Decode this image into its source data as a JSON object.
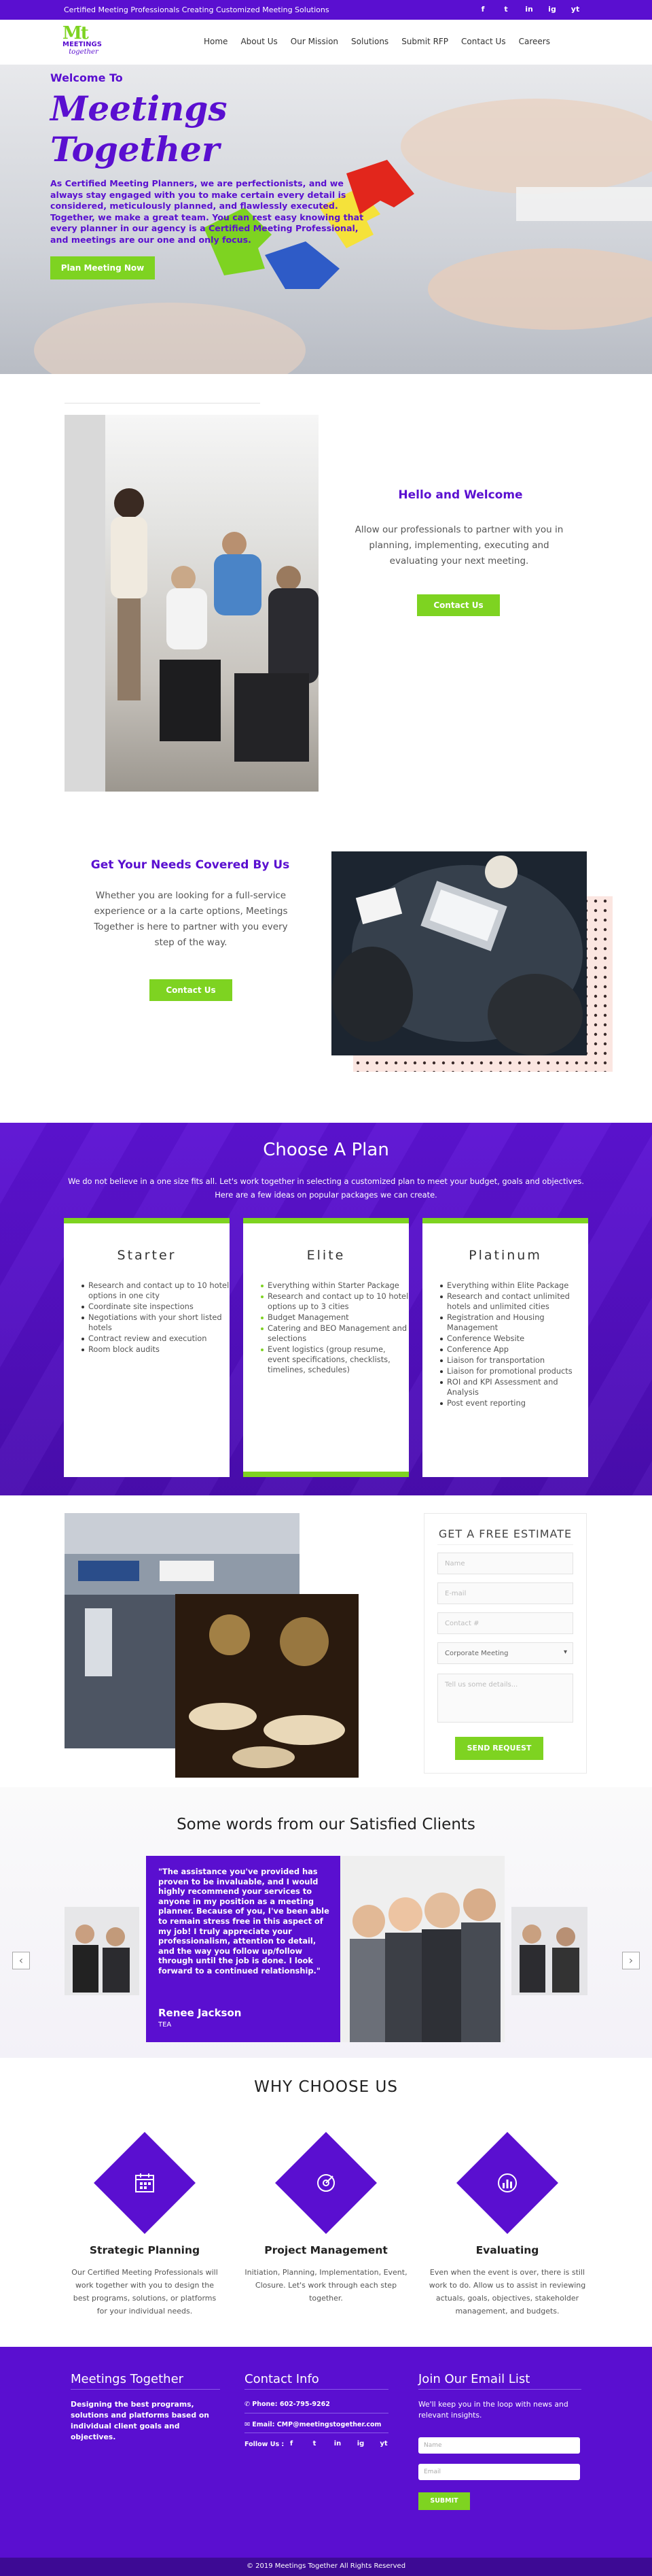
{
  "topbar": {
    "tagline": "Certified Meeting Professionals Creating Customized Meeting Solutions",
    "social": [
      "f",
      "t",
      "in",
      "ig",
      "yt"
    ]
  },
  "nav": {
    "logo_letters": "Mt",
    "logo_text": "MEETINGS",
    "logo_script": "together",
    "items": [
      "Home",
      "About Us",
      "Our Mission",
      "Solutions",
      "Submit RFP",
      "Contact Us",
      "Careers"
    ]
  },
  "hero": {
    "subtitle": "Welcome To",
    "title": "Meetings Together",
    "paragraph": "As Certified Meeting Planners, we are perfectionists, and we always stay engaged with you to make certain every detail is considered, meticulously planned, and flawlessly executed. Together, we make a great team. You can rest easy knowing that every planner in our agency is a Certified Meeting Professional, and meetings are our one and only focus.",
    "cta": "Plan Meeting Now"
  },
  "hello": {
    "title": "Hello and Welcome",
    "text": "Allow our professionals to partner with you in planning, implementing, executing and evaluating your next meeting.",
    "cta": "Contact Us"
  },
  "needs": {
    "title": "Get Your Needs Covered By Us",
    "text": "Whether you are looking for a full-service experience or a la carte options, Meetings Together is here to partner with you every step of the way.",
    "cta": "Contact Us"
  },
  "plans": {
    "title": "Choose A Plan",
    "intro": "We do not believe in a one size fits all. Let's work together in selecting a customized plan to meet your budget, goals and objectives. Here are a few ideas on popular packages we can create.",
    "cards": [
      {
        "name": "Starter",
        "items": [
          "Research and contact up to 10 hotel options in one city",
          "Coordinate site inspections",
          "Negotiations with your short listed hotels",
          "Contract review and execution",
          "Room block audits"
        ]
      },
      {
        "name": "Elite",
        "items": [
          "Everything within Starter Package",
          "Research and contact up to 10 hotel options up to 3 cities",
          "Budget Management",
          "Catering and BEO Management and selections",
          "Event logistics (group resume, event specifications, checklists, timelines, schedules)"
        ]
      },
      {
        "name": "Platinum",
        "items": [
          "Everything within Elite Package",
          "Research and contact unlimited hotels and unlimited cities",
          "Registration and Housing Management",
          "Conference Website",
          "Conference App",
          "Liaison for transportation",
          "Liaison for promotional products",
          "ROI and KPI Assessment and Analysis",
          "Post event reporting"
        ]
      }
    ]
  },
  "estimate": {
    "title": "GET A FREE ESTIMATE",
    "name_ph": "Name",
    "email_ph": "E-mail",
    "contact_ph": "Contact #",
    "select": "Corporate Meeting",
    "message_ph": "Tell us some details...",
    "submit": "SEND REQUEST"
  },
  "testimonials": {
    "title": "Some words from our Satisfied Clients",
    "quote": "\"The assistance you've provided has proven to be invaluable, and I would highly recommend your services to anyone in my position as a meeting planner. Because of you, I've been able to remain stress free in this aspect of my job! I truly appreciate your professionalism, attention to detail, and the way you follow up/follow through until the job is done. I look forward to a continued relationship.\"",
    "author": "Renee Jackson",
    "org": "TEA"
  },
  "why": {
    "title": "WHY CHOOSE US",
    "items": [
      {
        "title": "Strategic Planning",
        "text": "Our Certified Meeting Professionals will work together with you to design the best programs, solutions, or platforms for your individual needs."
      },
      {
        "title": "Project Management",
        "text": "Initiation, Planning, Implementation, Event, Closure. Let's work through each step together."
      },
      {
        "title": "Evaluating",
        "text": "Even when the event is over, there is still work to do. Allow us to assist in reviewing actuals, goals, objectives, stakeholder management, and budgets."
      }
    ]
  },
  "footer": {
    "col1_title": "Meetings Together",
    "col1_text": "Designing the best programs, solutions and platforms based on individual client goals and objectives.",
    "col2_title": "Contact Info",
    "phone": "Phone: 602-795-9262",
    "email": "Email: CMP@meetingstogether.com",
    "follow": "Follow Us :",
    "col3_title": "Join Our Email List",
    "col3_text": "We'll keep you in the loop with news and relevant insights.",
    "name_ph": "Name",
    "email_ph": "Email",
    "submit": "SUBMIT",
    "copyright": "© 2019 Meetings Together All Rights Reserved"
  }
}
